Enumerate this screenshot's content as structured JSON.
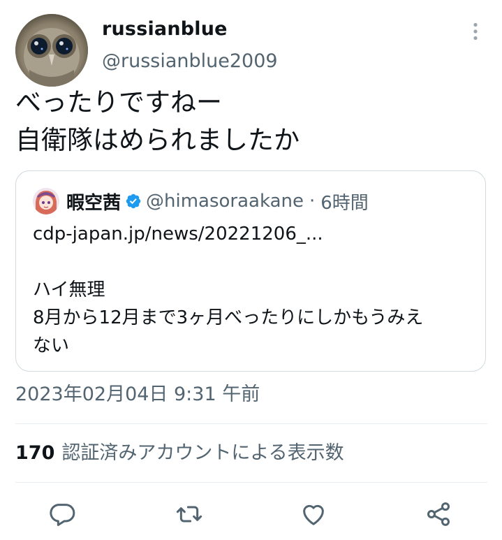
{
  "tweet": {
    "display_name": "russianblue",
    "handle": "@russianblue2009",
    "text_lines": [
      "べったりですねー",
      "自衛隊はめられましたか"
    ],
    "avatar_icon": "owl-avatar",
    "more_icon": "more-vertical-icon"
  },
  "quote": {
    "display_name": "暇空茜",
    "verified_icon": "verified-badge-icon",
    "handle": "@himasoraakane",
    "separator": "·",
    "time": "6時間",
    "body_lines": [
      "cdp-japan.jp/news/20221206_...",
      "",
      "ハイ無理",
      "8月から12月まで3ヶ月べったりにしかもうみえ",
      "ない"
    ]
  },
  "timestamp": "2023年02月04日 9:31 午前",
  "views": {
    "count": "170",
    "label": "認証済みアカウントによる表示数"
  },
  "actions": {
    "reply_icon": "reply-icon",
    "retweet_icon": "retweet-icon",
    "like_icon": "like-icon",
    "share_icon": "share-icon"
  },
  "colors": {
    "text_primary": "#0f1419",
    "text_secondary": "#536471",
    "border": "#cfd9de",
    "verified_blue": "#1d9bf0"
  }
}
